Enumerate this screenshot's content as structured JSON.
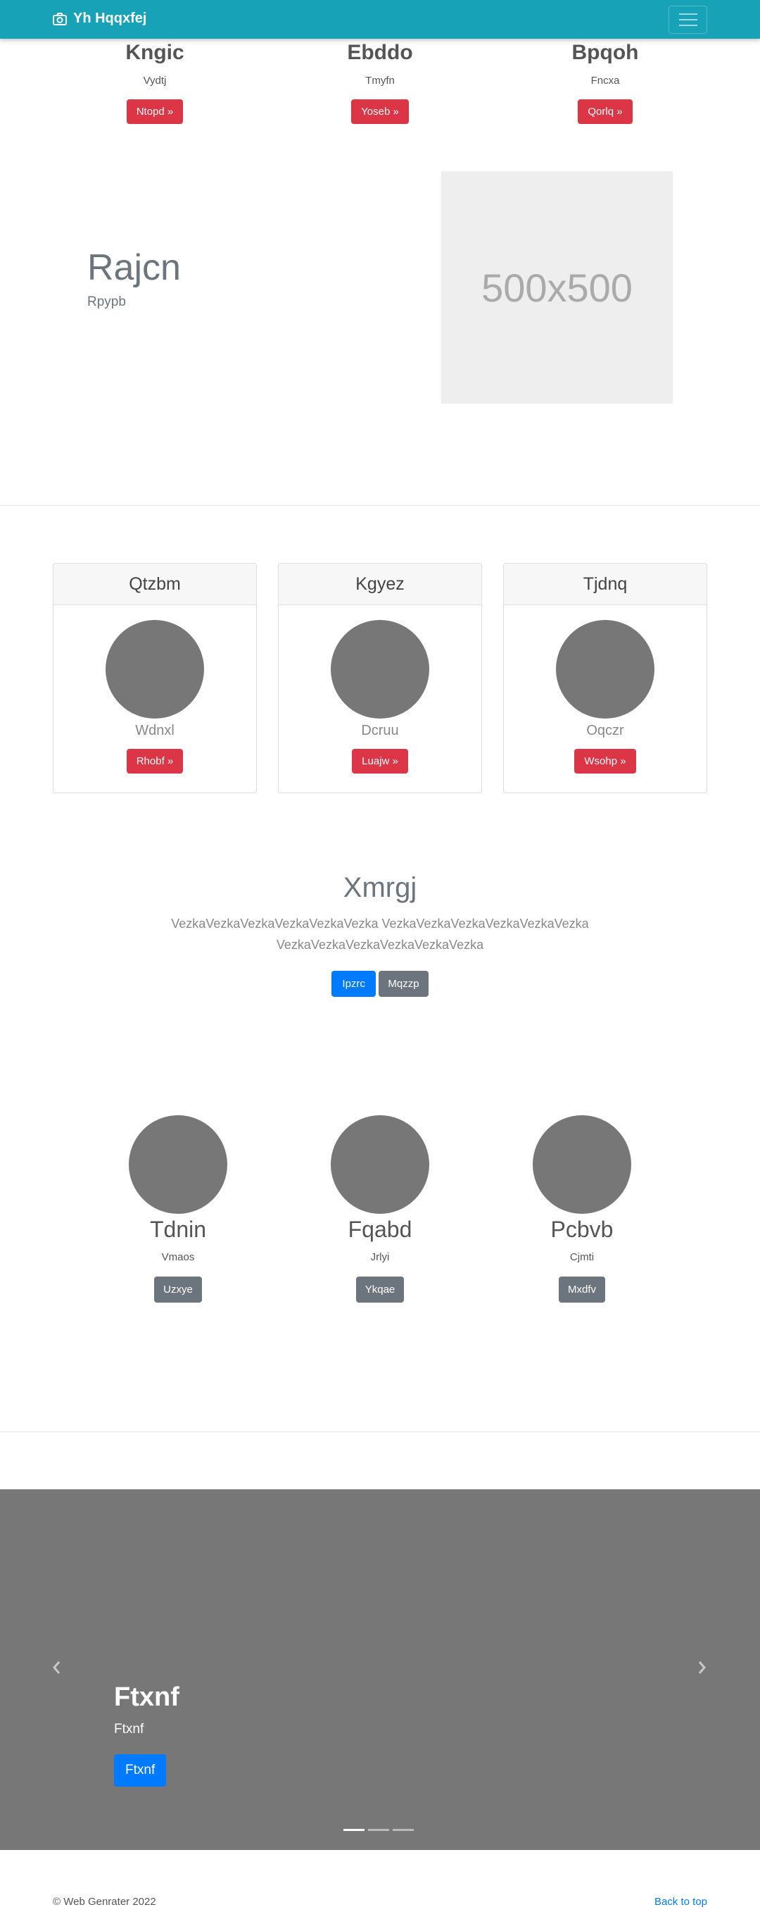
{
  "navbar": {
    "brand": "Yh Hqqxfej",
    "brand_icon": "camera-icon",
    "toggler_icon": "hamburger-icon"
  },
  "top_columns": [
    {
      "title": "Kngic",
      "subtitle": "Vydtj",
      "button": "Ntopd »"
    },
    {
      "title": "Ebddo",
      "subtitle": "Tmyfn",
      "button": "Yoseb »"
    },
    {
      "title": "Bpqoh",
      "subtitle": "Fncxa",
      "button": "Qorlq »"
    }
  ],
  "feature": {
    "title": "Rajcn",
    "subtitle": "Rpypb",
    "placeholder": "500x500"
  },
  "cards": [
    {
      "header": "Qtzbm",
      "text": "Wdnxl",
      "button": "Rhobf »"
    },
    {
      "header": "Kgyez",
      "text": "Dcruu",
      "button": "Luajw »"
    },
    {
      "header": "Tjdnq",
      "text": "Oqczr",
      "button": "Wsohp »"
    }
  ],
  "center": {
    "title": "Xmrgj",
    "text": "VezkaVezkaVezkaVezkaVezkaVezka VezkaVezkaVezkaVezkaVezkaVezka VezkaVezkaVezkaVezkaVezkaVezka",
    "primary_button": "Ipzrc",
    "secondary_button": "Mqzzp"
  },
  "profiles": [
    {
      "name": "Tdnin",
      "subtitle": "Vmaos",
      "button": "Uzxye"
    },
    {
      "name": "Fqabd",
      "subtitle": "Jrlyi",
      "button": "Ykqae"
    },
    {
      "name": "Pcbvb",
      "subtitle": "Cjmti",
      "button": "Mxdfv"
    }
  ],
  "carousel": {
    "title": "Ftxnf",
    "subtitle": "Ftxnf",
    "button": "Ftxnf",
    "slide_count": 3,
    "active_slide": 1
  },
  "footer": {
    "copyright": "© Web Genrater 2022",
    "back_to_top": "Back to top"
  },
  "colors": {
    "navbar": "#17a2b8",
    "danger": "#dc3545",
    "primary": "#007bff",
    "secondary": "#6c757d",
    "carousel_bg": "#777777"
  }
}
